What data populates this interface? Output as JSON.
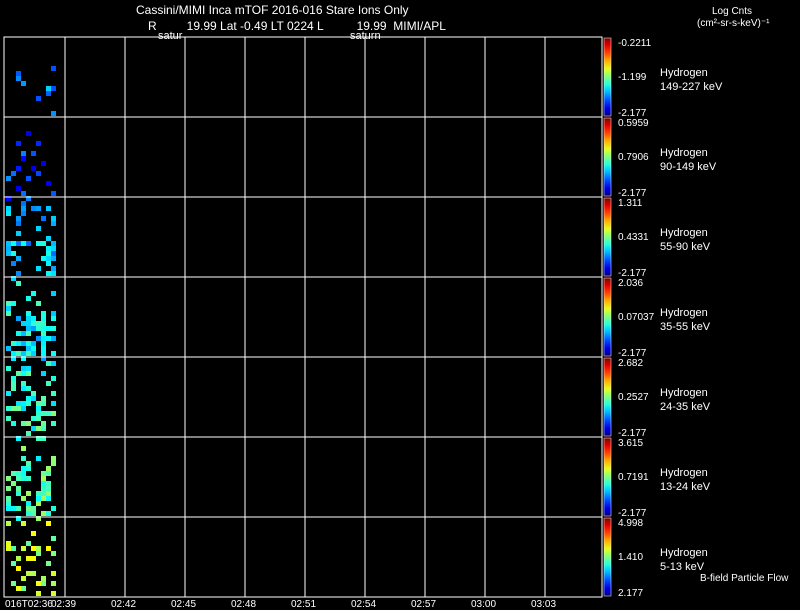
{
  "header": {
    "title": "Cassini/MIMI Inca mTOF  2016-016   Stare   Ions Only",
    "subtitle": "R         19.99 Lat -0.49 LT 0224 L          19.99  MIMI/APL",
    "overlay_left": "satur",
    "overlay_mid": "saturn"
  },
  "units": {
    "line1": "Log Cnts",
    "line2": "(cm²-sr-s-keV)⁻¹"
  },
  "footer": {
    "bfield": "B-field Particle Flow"
  },
  "chart_data": {
    "type": "heatmap",
    "x_ticks": [
      "016T02:36",
      "02:39",
      "02:42",
      "02:45",
      "02:48",
      "02:51",
      "02:54",
      "02:57",
      "03:00",
      "03:03"
    ],
    "panels": [
      {
        "species": "Hydrogen",
        "energy": "149-227 keV",
        "cb_max": "-0.2211",
        "cb_mid": "-1.199",
        "cb_min": "-2.177",
        "norm_level": 0.25,
        "density": 0.12
      },
      {
        "species": "Hydrogen",
        "energy": "90-149 keV",
        "cb_max": "0.5959",
        "cb_mid": "0.7906",
        "cb_min": "-2.177",
        "norm_level": 0.18,
        "density": 0.22
      },
      {
        "species": "Hydrogen",
        "energy": "55-90 keV",
        "cb_max": "1.311",
        "cb_mid": "0.4331",
        "cb_min": "-2.177",
        "norm_level": 0.32,
        "density": 0.35
      },
      {
        "species": "Hydrogen",
        "energy": "35-55 keV",
        "cb_max": "2.036",
        "cb_mid": "0.07037",
        "cb_min": "-2.177",
        "norm_level": 0.36,
        "density": 0.55
      },
      {
        "species": "Hydrogen",
        "energy": "24-35 keV",
        "cb_max": "2.682",
        "cb_mid": "0.2527",
        "cb_min": "-2.177",
        "norm_level": 0.42,
        "density": 0.45
      },
      {
        "species": "Hydrogen",
        "energy": "13-24 keV",
        "cb_max": "3.615",
        "cb_mid": "0.7191",
        "cb_min": "-2.177",
        "norm_level": 0.45,
        "density": 0.45
      },
      {
        "species": "Hydrogen",
        "energy": "5-13 keV",
        "cb_max": "4.998",
        "cb_mid": "1.410",
        "cb_min": "2.177",
        "norm_level": 0.55,
        "density": 0.25
      }
    ]
  }
}
